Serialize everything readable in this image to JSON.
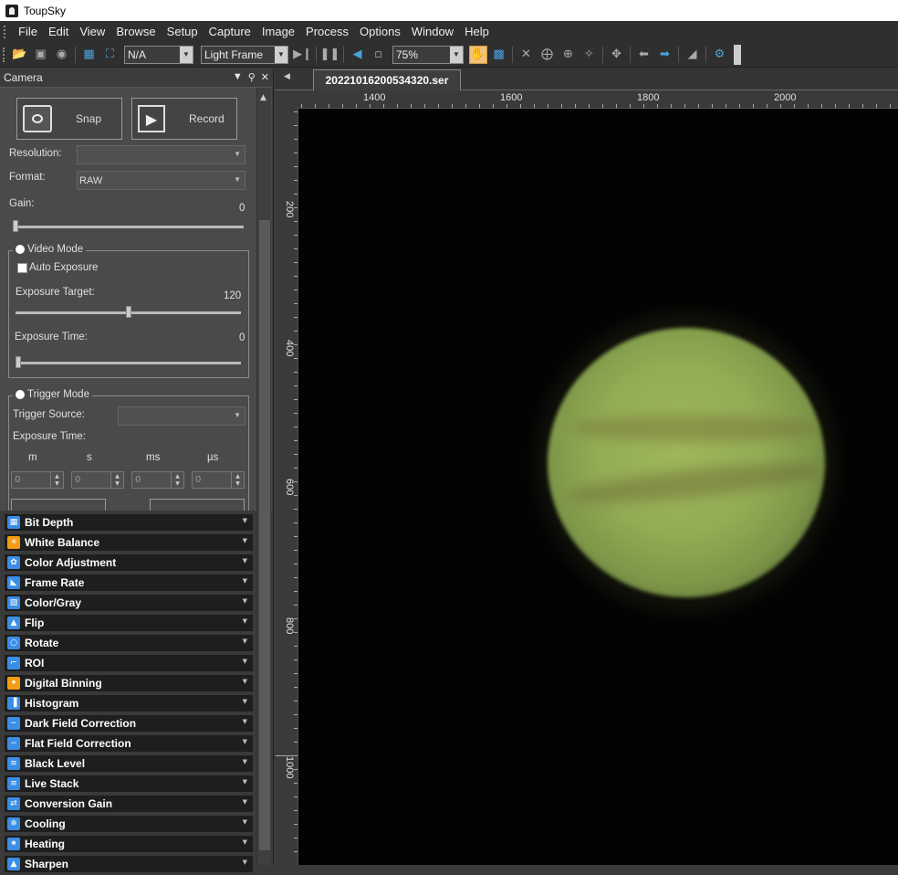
{
  "window": {
    "title": "ToupSky"
  },
  "menu": [
    "File",
    "Edit",
    "View",
    "Browse",
    "Setup",
    "Capture",
    "Image",
    "Process",
    "Options",
    "Window",
    "Help"
  ],
  "toolbar": {
    "binning_value": "N/A",
    "frame_type": "Light Frame",
    "zoom": "75%"
  },
  "camera_panel": {
    "title": "Camera",
    "snap_label": "Snap",
    "record_label": "Record",
    "resolution_label": "Resolution:",
    "resolution_value": "",
    "format_label": "Format:",
    "format_value": "RAW",
    "gain_label": "Gain:",
    "gain_value": "0",
    "video_mode_label": "Video Mode",
    "auto_exposure_label": "Auto Exposure",
    "exposure_target_label": "Exposure Target:",
    "exposure_target_value": "120",
    "exposure_time_label": "Exposure Time:",
    "exposure_time_value": "0",
    "trigger_mode_label": "Trigger Mode",
    "trigger_source_label": "Trigger Source:",
    "trigger_exposure_label": "Exposure Time:",
    "time_units": [
      "m",
      "s",
      "ms",
      "µs"
    ],
    "time_values": [
      "0",
      "0",
      "0",
      "0"
    ]
  },
  "sections": [
    {
      "label": "Bit Depth",
      "color": "#3a8ee6"
    },
    {
      "label": "White Balance",
      "color": "#f39c12"
    },
    {
      "label": "Color Adjustment",
      "color": "#3a8ee6"
    },
    {
      "label": "Frame Rate",
      "color": "#3a8ee6"
    },
    {
      "label": "Color/Gray",
      "color": "#3a8ee6"
    },
    {
      "label": "Flip",
      "color": "#3a8ee6"
    },
    {
      "label": "Rotate",
      "color": "#3a8ee6"
    },
    {
      "label": "ROI",
      "color": "#3a8ee6"
    },
    {
      "label": "Digital Binning",
      "color": "#f39c12"
    },
    {
      "label": "Histogram",
      "color": "#3a8ee6"
    },
    {
      "label": "Dark Field Correction",
      "color": "#3a8ee6"
    },
    {
      "label": "Flat Field Correction",
      "color": "#3a8ee6"
    },
    {
      "label": "Black Level",
      "color": "#3a8ee6"
    },
    {
      "label": "Live Stack",
      "color": "#3a8ee6"
    },
    {
      "label": "Conversion Gain",
      "color": "#3a8ee6"
    },
    {
      "label": "Cooling",
      "color": "#3a8ee6"
    },
    {
      "label": "Heating",
      "color": "#3a8ee6"
    },
    {
      "label": "Sharpen",
      "color": "#3a8ee6"
    }
  ],
  "document": {
    "tab_title": "20221016200534320.ser",
    "h_ruler_labels": [
      "1400",
      "1600",
      "1800",
      "2000"
    ],
    "v_ruler_labels": [
      "200",
      "400",
      "600",
      "800",
      "1000"
    ]
  }
}
